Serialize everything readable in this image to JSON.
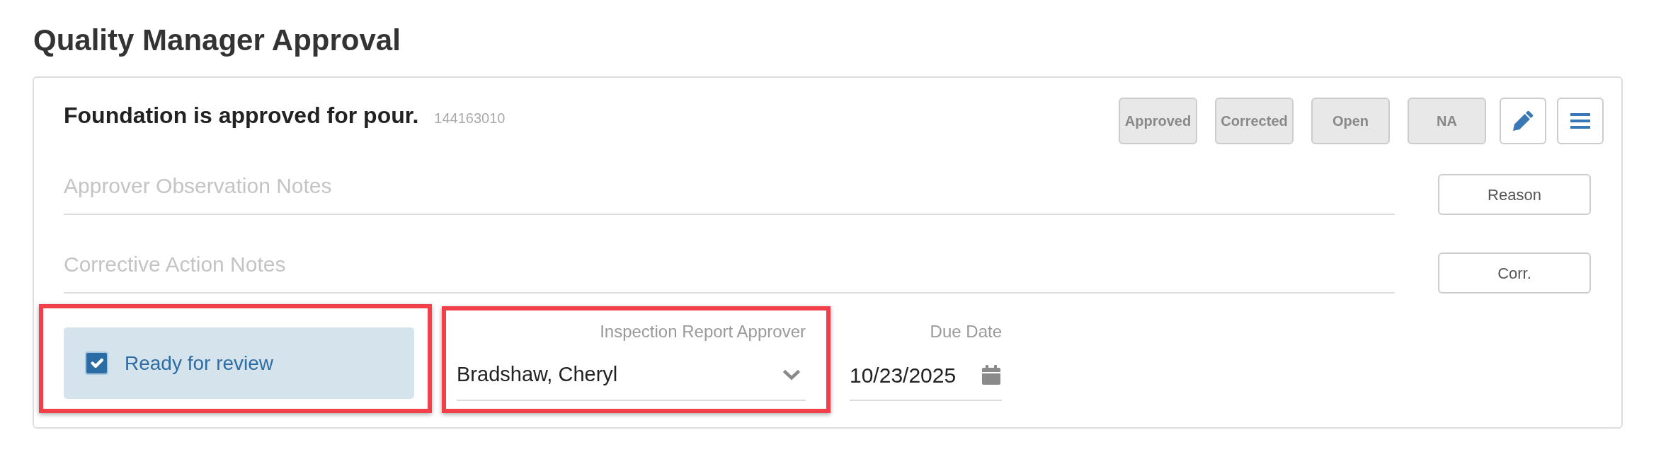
{
  "header": {
    "title": "Quality Manager Approval"
  },
  "checklist_item": {
    "title": "Foundation is approved for pour.",
    "number": "144163010",
    "status_buttons": [
      {
        "label": "Approved",
        "selected": false
      },
      {
        "label": "Corrected",
        "selected": false
      },
      {
        "label": "Open",
        "selected": false
      },
      {
        "label": "NA",
        "selected": false
      }
    ],
    "notes": [
      {
        "placeholder": "Approver Observation Notes",
        "button": "Reason"
      },
      {
        "placeholder": "Corrective Action Notes",
        "button": "Corr."
      }
    ],
    "ready_for_review": {
      "label": "Ready for review",
      "checked": true,
      "highlighted": true
    },
    "approver": {
      "label": "Inspection Report Approver",
      "value": "Bradshaw, Cheryl",
      "highlighted": true
    },
    "due_date": {
      "label": "Due Date",
      "value": "10/23/2025"
    }
  }
}
